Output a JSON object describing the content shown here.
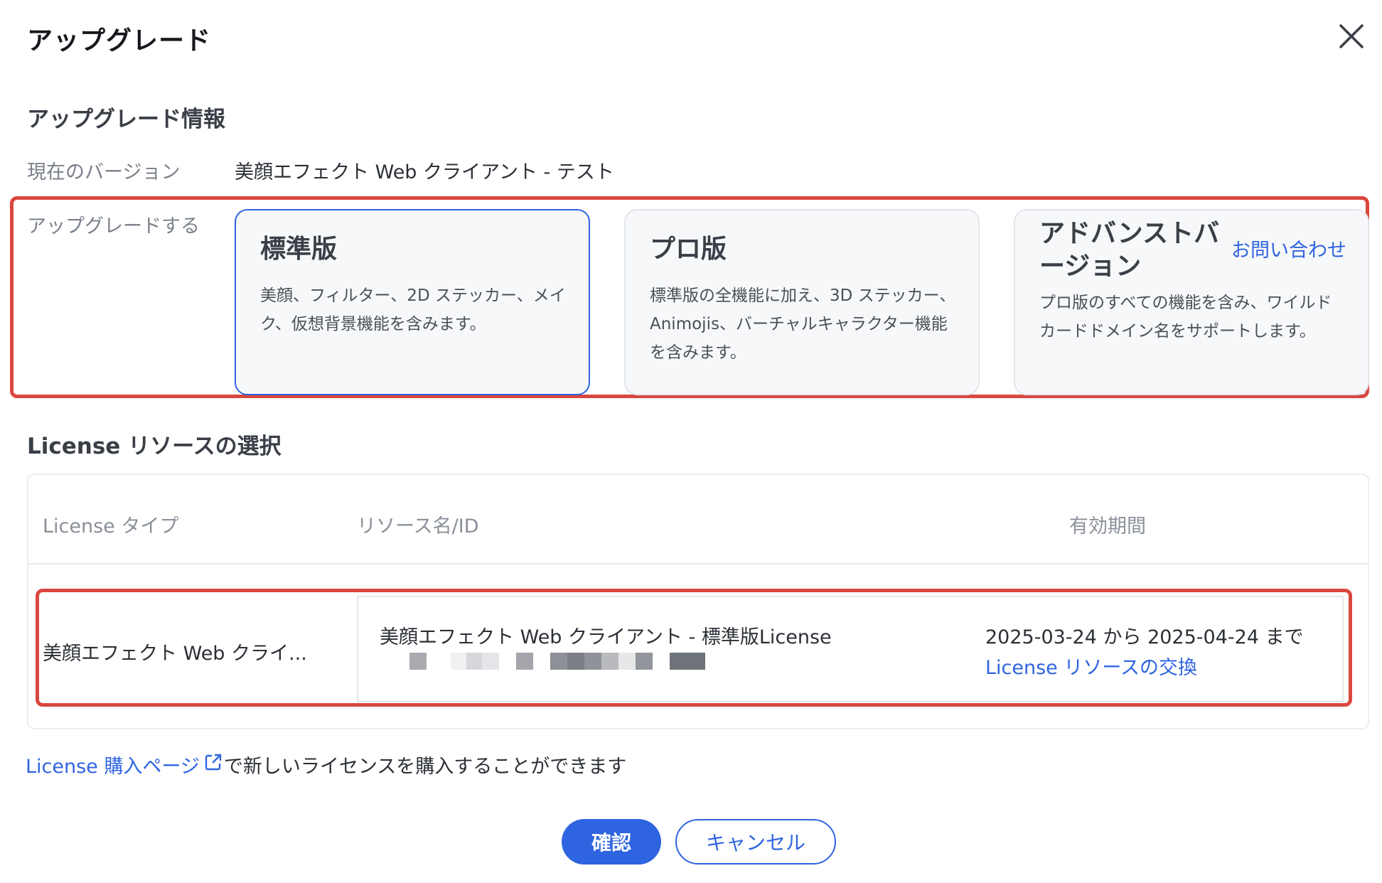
{
  "dialog": {
    "title": "アップグレード"
  },
  "upgrade_info": {
    "section_title": "アップグレード情報",
    "current_version_label": "現在のバージョン",
    "current_version_value": "美顔エフェクト Web クライアント - テスト",
    "upgrade_to_label": "アップグレードする",
    "plans": [
      {
        "title": "標準版",
        "description": "美顔、フィルター、2D ステッカー、メイク、仮想背景機能を含みます。",
        "selected": true
      },
      {
        "title": "プロ版",
        "description": "標準版の全機能に加え、3D ステッカー、Animojis、バーチャルキャラクター機能を含みます。",
        "selected": false
      },
      {
        "title": "アドバンストバージョン",
        "contact_link": "お問い合わせ",
        "description": "プロ版のすべての機能を含み、ワイルドカードドメイン名をサポートします。",
        "selected": false
      }
    ]
  },
  "license_selection": {
    "section_title": "License リソースの選択",
    "columns": [
      "License タイプ",
      "リソース名/ID",
      "有効期間"
    ],
    "row": {
      "type": "美顔エフェクト Web クライ...",
      "resource_name": "美顔エフェクト Web クライアント - 標準版License",
      "validity": "2025-03-24 から 2025-04-24 まで",
      "swap_link": "License リソースの交換"
    }
  },
  "footer": {
    "purchase_link": "License 購入ページ",
    "purchase_suffix": "で新しいライセンスを購入することができます",
    "confirm_label": "確認",
    "cancel_label": "キャンセル"
  },
  "colors": {
    "accent": "#2f64e0",
    "highlight_box": "#d9473e"
  }
}
